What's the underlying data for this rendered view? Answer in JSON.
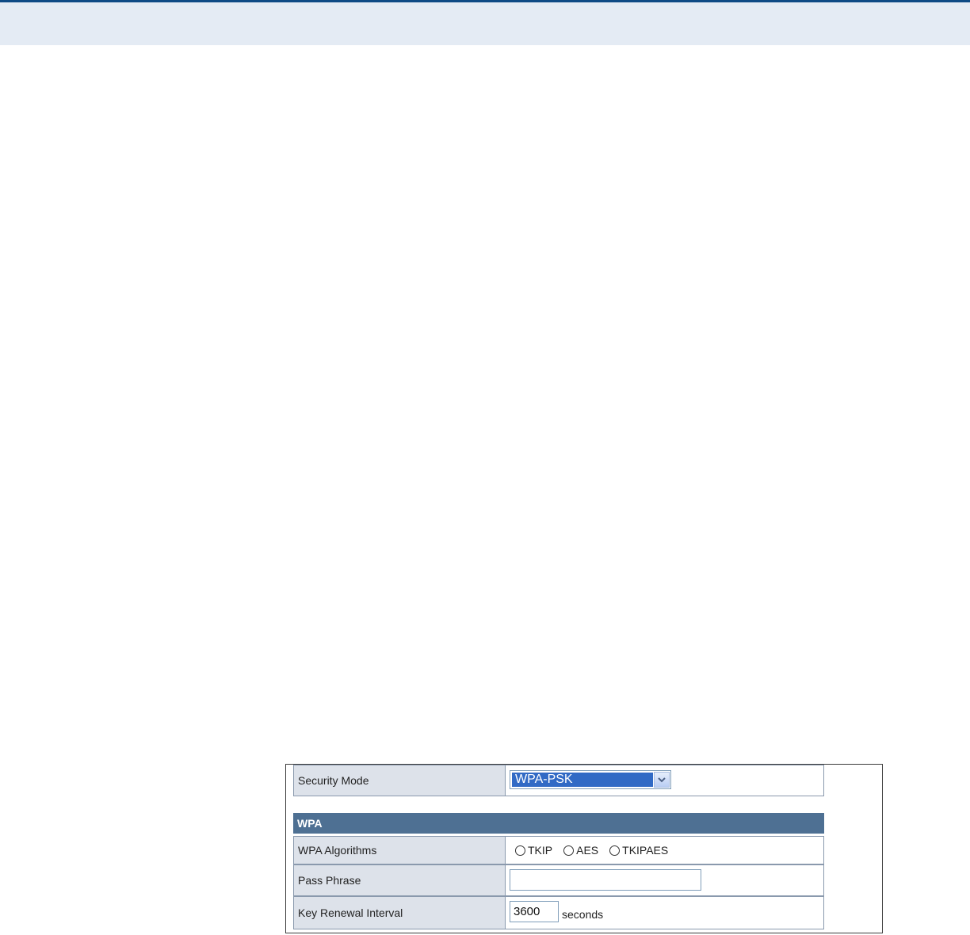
{
  "colors": {
    "top_rule": "#0e4a85",
    "header_band": "#e4ebf4",
    "section_header": "#4e7093",
    "label_cell": "#dde2ea",
    "selection": "#316ac5"
  },
  "form": {
    "security_mode": {
      "label": "Security Mode",
      "selected": "WPA-PSK"
    },
    "wpa_section": {
      "title": "WPA"
    },
    "wpa_algorithms": {
      "label": "WPA Algorithms",
      "options": [
        "TKIP",
        "AES",
        "TKIPAES"
      ]
    },
    "pass_phrase": {
      "label": "Pass Phrase",
      "value": ""
    },
    "key_renewal": {
      "label": "Key Renewal Interval",
      "value": "3600",
      "unit": "seconds"
    }
  },
  "icons": {
    "dropdown": "chevron-down-icon",
    "radio": "radio-unchecked-icon"
  }
}
